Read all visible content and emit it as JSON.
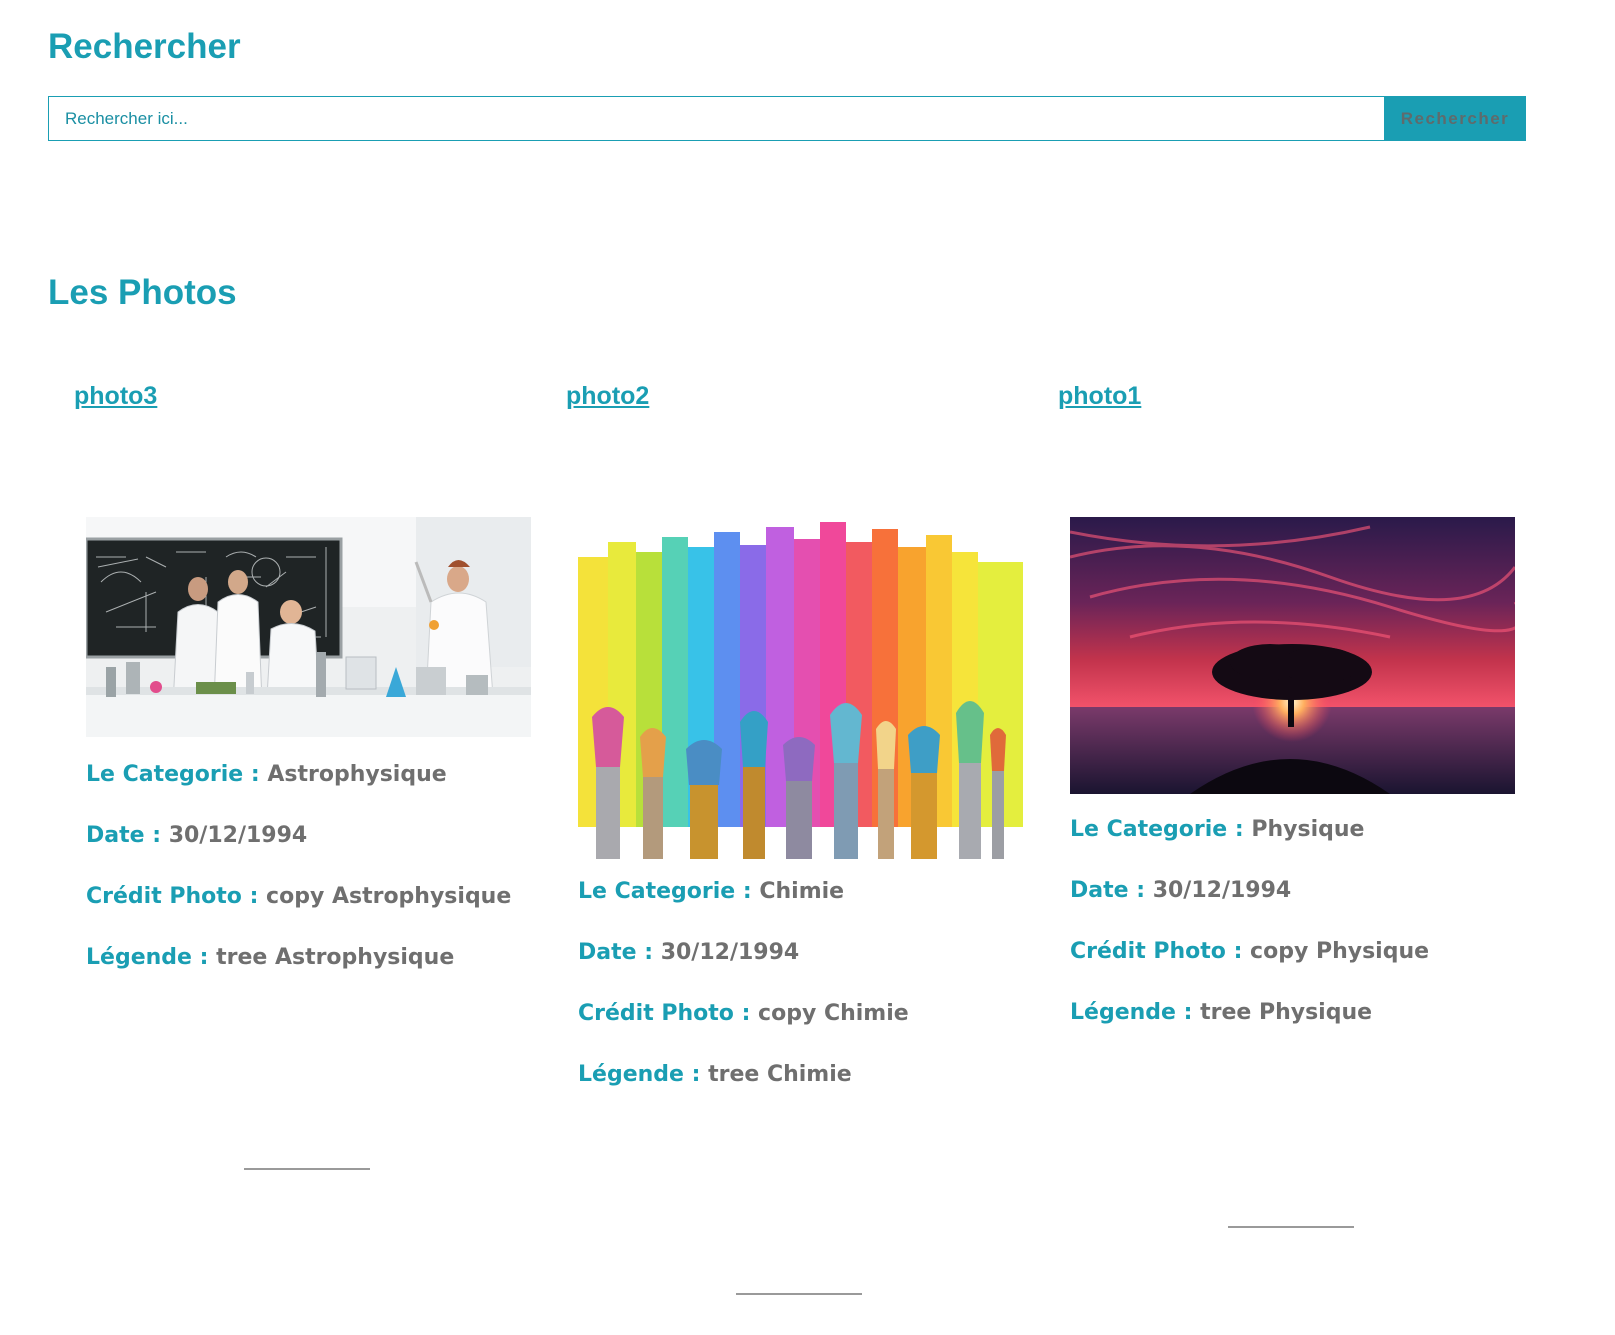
{
  "search": {
    "title": "Rechercher",
    "placeholder": "Rechercher ici...",
    "button_label": "Rechercher"
  },
  "photos": {
    "title": "Les Photos",
    "items": [
      {
        "link": "photo3",
        "image_icon": "laboratory-scientists-image",
        "category_label": "Le Categorie :",
        "category_value": "Astrophysique",
        "date_label": "Date :",
        "date_value": "30/12/1994",
        "credit_label": "Crédit Photo :",
        "credit_value": "copy Astrophysique",
        "legend_label": "Légende :",
        "legend_value": "tree Astrophysique"
      },
      {
        "link": "photo2",
        "image_icon": "paintbrushes-rainbow-image",
        "category_label": "Le Categorie :",
        "category_value": "Chimie",
        "date_label": "Date :",
        "date_value": "30/12/1994",
        "credit_label": "Crédit Photo :",
        "credit_value": "copy Chimie",
        "legend_label": "Légende :",
        "legend_value": "tree Chimie"
      },
      {
        "link": "photo1",
        "image_icon": "tree-sunset-image",
        "category_label": "Le Categorie :",
        "category_value": "Physique",
        "date_label": "Date :",
        "date_value": "30/12/1994",
        "credit_label": "Crédit Photo :",
        "credit_value": "copy Physique",
        "legend_label": "Légende :",
        "legend_value": "tree Physique"
      }
    ]
  },
  "colors": {
    "accent": "#1a9eb3",
    "value_text": "#6f6f6f",
    "divider": "#9a9a9a"
  }
}
